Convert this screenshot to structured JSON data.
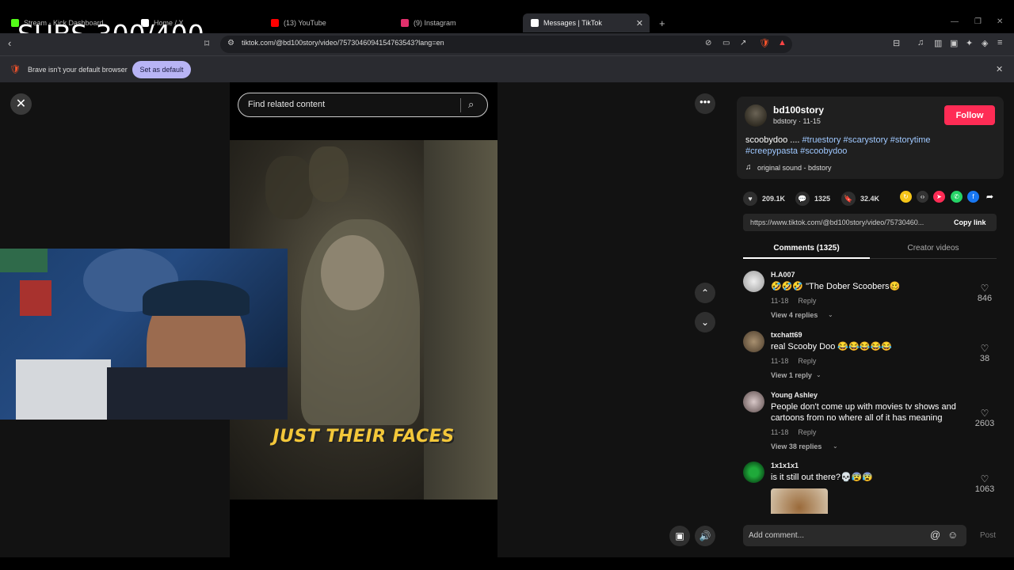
{
  "overlay_text": "SUBS 300/400",
  "tabs": [
    {
      "label": "Stream - Kick Dashboard",
      "color": "#53fc18"
    },
    {
      "label": "Home / X",
      "color": "#ffffff"
    },
    {
      "label": "(13) YouTube",
      "color": "#ff0000"
    },
    {
      "label": "(9) Instagram",
      "color": "#e1306c"
    },
    {
      "label": "Messages | TikTok",
      "color": "#ffffff"
    }
  ],
  "new_tab": "+",
  "address": {
    "url": "tiktok.com/@bd100story/video/7573046094154763543?lang=en"
  },
  "infobar": {
    "message": "Brave isn't your default browser",
    "button": "Set as default"
  },
  "video": {
    "search_placeholder": "Find related content",
    "caption": "JUST THEIR FACES"
  },
  "post": {
    "username": "bd100story",
    "sub": "bdstory · 11-15",
    "follow": "Follow",
    "desc_text": "scoobydoo .... ",
    "hashtags_line1": "#truestory #scarystory #storytime",
    "hashtags_line2": "#creepypasta #scoobydoo",
    "sound": "original sound - bdstory",
    "likes": "209.1K",
    "comments": "1325",
    "saves": "32.4K",
    "link": "https://www.tiktok.com/@bd100story/video/75730460...",
    "copy_link": "Copy link"
  },
  "panel_tabs": {
    "comments": "Comments (1325)",
    "creator": "Creator videos"
  },
  "comments": [
    {
      "user": "H.A007",
      "text": "🤣🤣🤣 \"The Dober Scoobers🥴",
      "date": "11-18",
      "reply": "Reply",
      "replies": "View 4 replies",
      "likes": "846"
    },
    {
      "user": "txchatt69",
      "text": "real Scooby Doo 😂😂😂😂😂",
      "date": "11-18",
      "reply": "Reply",
      "replies": "View 1 reply",
      "likes": "38"
    },
    {
      "user": "Young Ashley",
      "text": "People don't come up with movies tv shows and cartoons from no where all of it has meaning",
      "date": "11-18",
      "reply": "Reply",
      "replies": "View 38 replies",
      "likes": "2603"
    },
    {
      "user": "1x1x1x1",
      "text": "is it still out there?💀😰😰",
      "likes": "1063"
    }
  ],
  "comment_input": {
    "placeholder": "Add comment...",
    "post": "Post"
  }
}
